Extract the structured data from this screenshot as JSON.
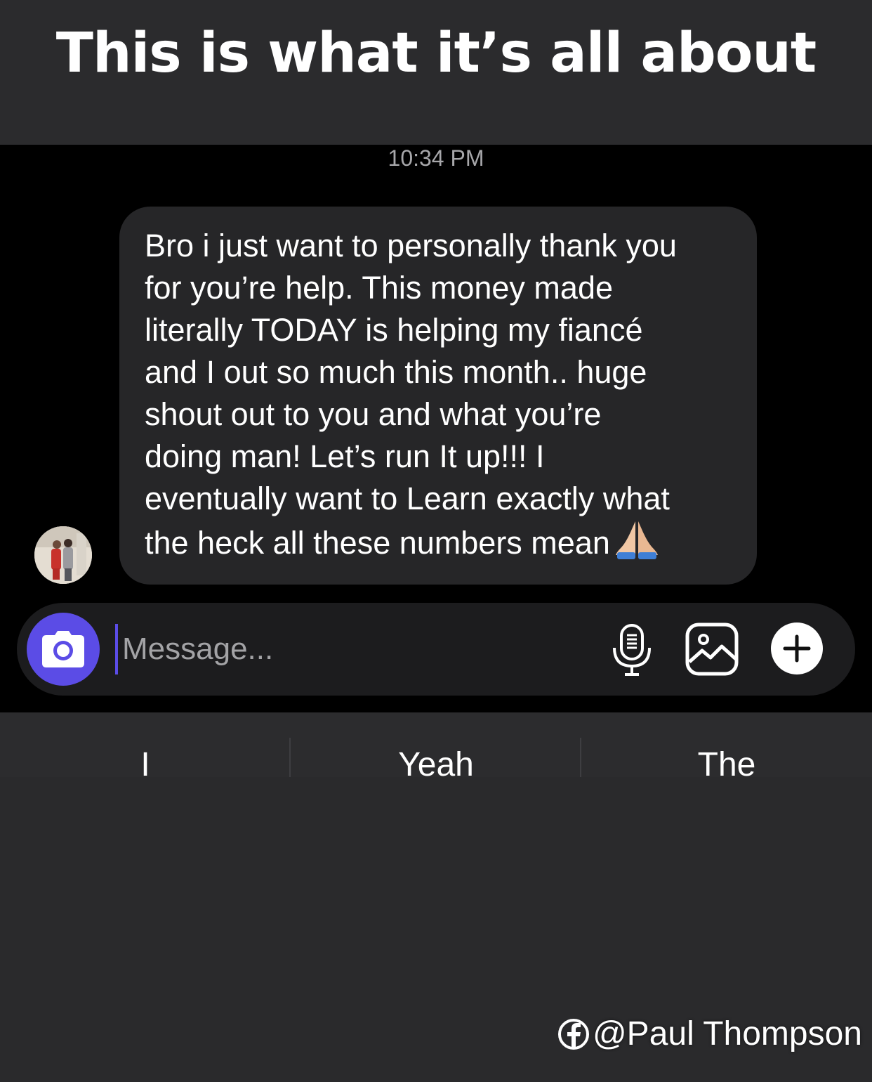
{
  "header": {
    "title": "This is what it’s all about"
  },
  "chat": {
    "timestamp": "10:34 PM",
    "message": {
      "text": "Bro i just want to personally thank you\nfor you’re help. This money made\nliterally TODAY is helping my fiancé\nand I out so much this month.. huge\nshout out to you and what you’re\ndoing man! Let’s run It up!!! I\neventually want to Learn exactly what\nthe heck all these numbers mean",
      "emoji": "🙏🏼"
    }
  },
  "composer": {
    "placeholder": "Message...",
    "accent_color": "#5b4ce6"
  },
  "suggestions": [
    "I",
    "Yeah",
    "The"
  ],
  "watermark": {
    "handle": "@Paul Thompson",
    "icon": "facebook-icon"
  }
}
